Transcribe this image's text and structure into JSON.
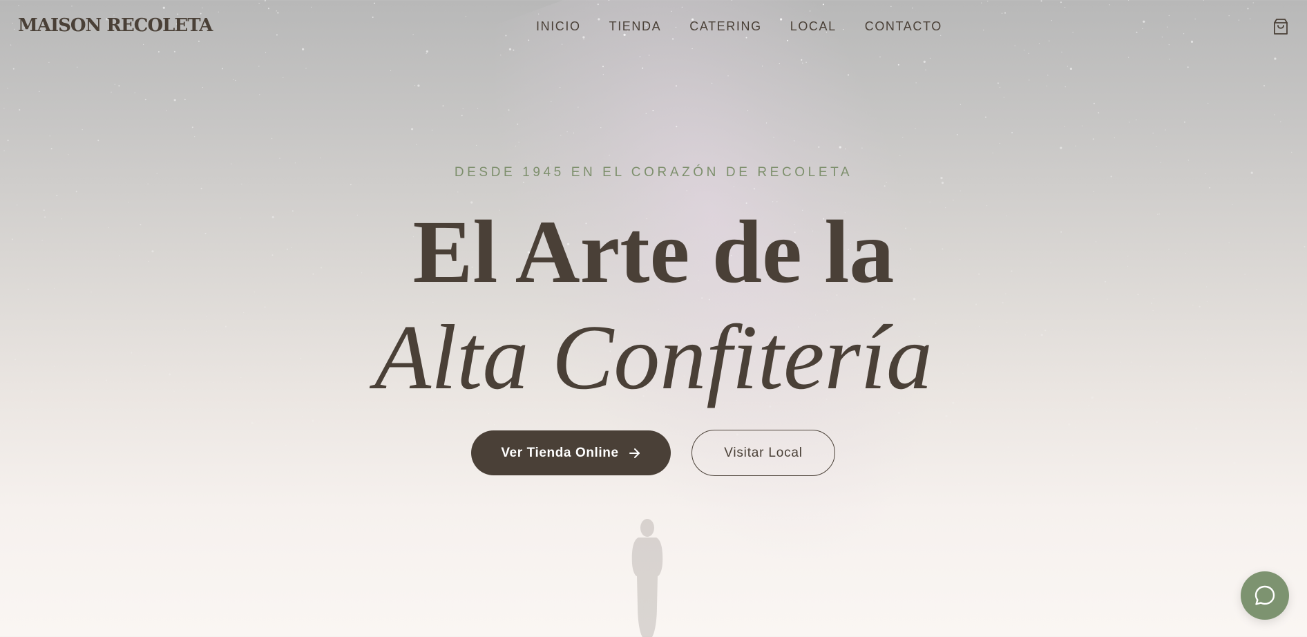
{
  "brand": {
    "logo_text": "MAISON RECOLETA"
  },
  "nav": {
    "items": [
      {
        "label": "INICIO"
      },
      {
        "label": "TIENDA"
      },
      {
        "label": "CATERING"
      },
      {
        "label": "LOCAL"
      },
      {
        "label": "CONTACTO"
      }
    ],
    "cart_icon": "shopping-bag-icon"
  },
  "hero": {
    "tagline": "DESDE 1945 EN EL CORAZÓN DE RECOLETA",
    "title_line1": "El Arte de la",
    "title_line2": "Alta Confitería",
    "primary_button": {
      "label": "Ver Tienda Online",
      "icon": "arrow-right-icon"
    },
    "secondary_button": {
      "label": "Visitar Local"
    }
  },
  "chat_widget": {
    "icon": "chat-bubble-icon"
  },
  "colors": {
    "text": "#4a4037",
    "accent_green": "#7d9370",
    "tagline_green": "#7d8f6c",
    "button_dark": "#4a4037"
  }
}
